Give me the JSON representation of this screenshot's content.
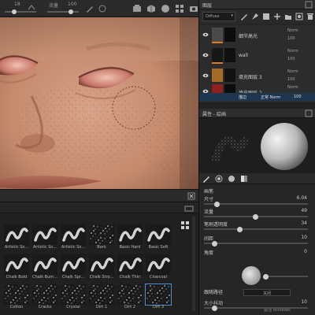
{
  "toolbar": {
    "brush_size": "18",
    "flow_label": "流量",
    "flow_value": "100",
    "size_slider_level": 0.3,
    "flow_slider_level": 0.75
  },
  "layers_panel": {
    "title": "图层",
    "channel": "Diffuse",
    "layers": [
      {
        "name": "细节高光",
        "blend": "Norm",
        "opacity": "100",
        "thumb_color": "#4a4a4a",
        "mask_color": "#0c0c0c",
        "visible": true
      },
      {
        "name": "wall",
        "blend": "Norm",
        "opacity": "100",
        "thumb_color": "#171717",
        "mask_color": "#101010",
        "visible": true
      },
      {
        "name": "填充图层 3",
        "blend": "Norm",
        "opacity": "100",
        "thumb_color": "#a36c2a",
        "mask_color": "#121212",
        "visible": true
      },
      {
        "name": "填充图层 2",
        "blend": "Norm",
        "opacity": "100",
        "thumb_color": "#8f2020",
        "mask_color": "#0c0c0c",
        "visible": true
      }
    ],
    "sub_row": {
      "label": "描边",
      "mode": "正常 Norm",
      "opacity": "100"
    },
    "blend_prefix": "Diffuse"
  },
  "properties_panel": {
    "title": "属性 - 绘画",
    "section": "画笔",
    "params": [
      {
        "label": "尺寸",
        "value": "6.04",
        "level": 0.12
      },
      {
        "label": "流量",
        "value": "49",
        "level": 0.49
      },
      {
        "label": "笔刷透明度",
        "value": "34",
        "level": 0.34
      },
      {
        "label": "间距",
        "value": "10",
        "level": 0.1
      },
      {
        "label": "角度",
        "value": "0",
        "level": 0.0
      },
      {
        "label": "跟随路径",
        "value": "关闭",
        "level": 0.0
      },
      {
        "label": "大小抖动",
        "value": "10",
        "level": 0.1
      }
    ],
    "watermark": "激活 Windows"
  },
  "brush_shelf": {
    "brushes": [
      {
        "label": "Artistic So...",
        "style": "stroke"
      },
      {
        "label": "Artistic So...",
        "style": "stroke"
      },
      {
        "label": "Artistic So...",
        "style": "stroke"
      },
      {
        "label": "Bark",
        "style": "noise"
      },
      {
        "label": "Basic Hard",
        "style": "stroke"
      },
      {
        "label": "Basic Soft",
        "style": "stroke"
      },
      {
        "label": "Chalk Bold",
        "style": "stroke"
      },
      {
        "label": "Chalk Bum...",
        "style": "stroke"
      },
      {
        "label": "Chalk Spr...",
        "style": "stroke"
      },
      {
        "label": "Chalk Stro...",
        "style": "stroke"
      },
      {
        "label": "Chalk Thin",
        "style": "stroke"
      },
      {
        "label": "Charcoal",
        "style": "stroke"
      },
      {
        "label": "Cotton",
        "style": "noise"
      },
      {
        "label": "Cracks",
        "style": "noise"
      },
      {
        "label": "Crystal",
        "style": "noise"
      },
      {
        "label": "Dirt 1",
        "style": "noise"
      },
      {
        "label": "Dirt 2",
        "style": "noise"
      },
      {
        "label": "Dirt 3",
        "style": "noise"
      }
    ],
    "selected_index": 17
  }
}
